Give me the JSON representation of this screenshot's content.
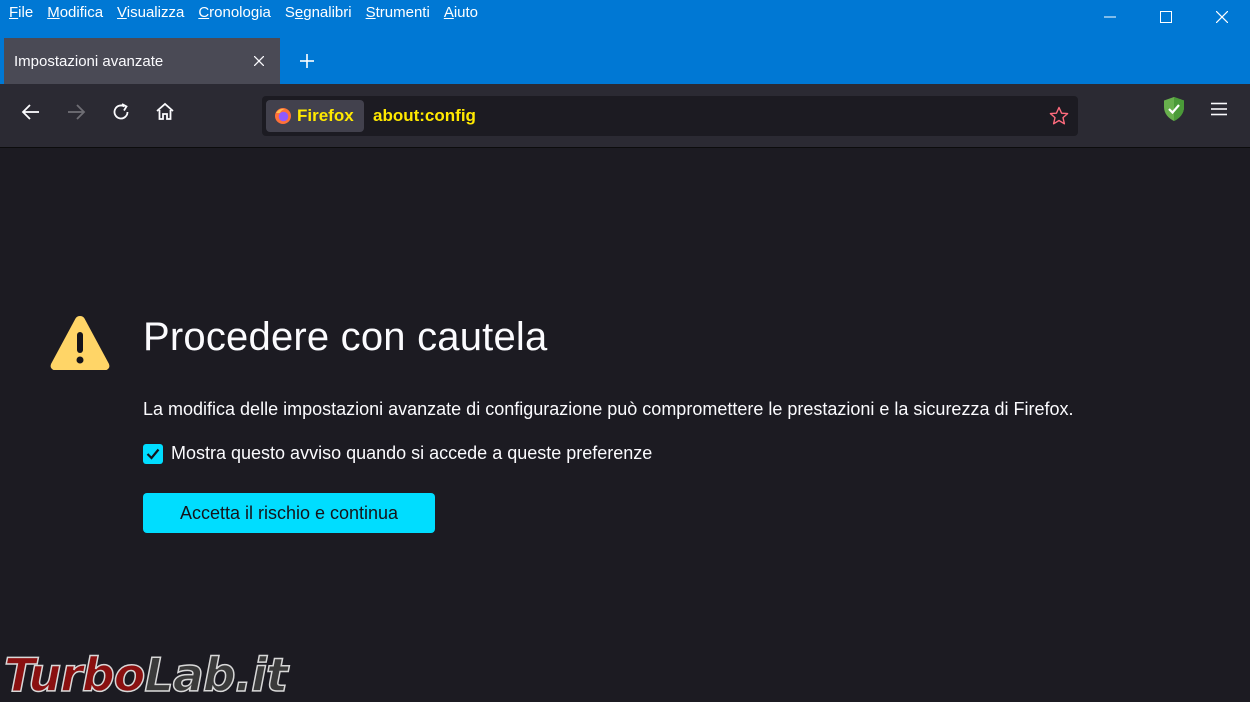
{
  "menu": {
    "items": [
      {
        "underline": "F",
        "rest": "ile"
      },
      {
        "underline": "M",
        "rest": "odifica"
      },
      {
        "underline": "V",
        "rest": "isualizza"
      },
      {
        "underline": "C",
        "rest": "ronologia"
      },
      {
        "pre": "S",
        "underline": "e",
        "rest": "gnalibri"
      },
      {
        "underline": "S",
        "rest": "trumenti"
      },
      {
        "underline": "A",
        "rest": "iuto"
      }
    ]
  },
  "tab": {
    "title": "Impostazioni avanzate"
  },
  "urlbar": {
    "identity_label": "Firefox",
    "url": "about:config"
  },
  "page": {
    "heading": "Procedere con cautela",
    "description": "La modifica delle impostazioni avanzate di configurazione può compromettere le prestazioni e la sicurezza di Firefox.",
    "checkbox_label": "Mostra questo avviso quando si accede a queste preferenze",
    "checkbox_checked": true,
    "accept_button": "Accetta il rischio e continua"
  },
  "watermark": {
    "part1": "Turbo",
    "part2": "Lab.it"
  },
  "colors": {
    "titlebar": "#0078d4",
    "accent": "#00ddff",
    "url_highlight": "#ffe900",
    "warning": "#ffd567",
    "content_bg": "#1c1b22"
  }
}
